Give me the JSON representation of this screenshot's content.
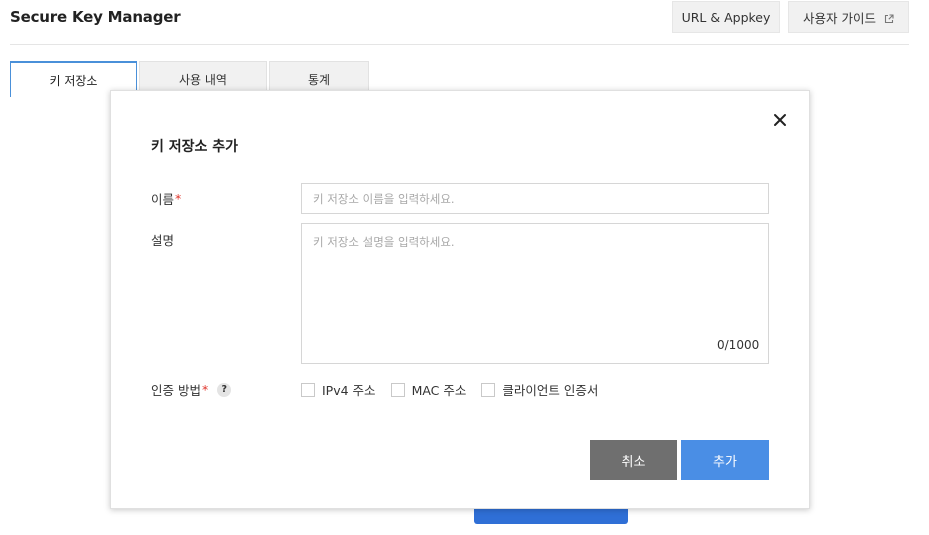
{
  "header": {
    "title": "Secure Key Manager",
    "url_appkey_label": "URL & Appkey",
    "user_guide_label": "사용자 가이드",
    "user_guide_icon": "external-link-icon"
  },
  "tabs": [
    {
      "label": "키 저장소",
      "active": true
    },
    {
      "label": "사용 내역",
      "active": false
    },
    {
      "label": "통계",
      "active": false
    }
  ],
  "modal": {
    "title": "키 저장소 추가",
    "close_icon": "close-icon",
    "name": {
      "label": "이름",
      "required_mark": "*",
      "placeholder": "키 저장소 이름을 입력하세요.",
      "value": ""
    },
    "description": {
      "label": "설명",
      "placeholder": "키 저장소 설명을 입력하세요.",
      "value": "",
      "char_count": "0/1000"
    },
    "auth_method": {
      "label": "인증 방법",
      "required_mark": "*",
      "help_icon_text": "?",
      "options": [
        {
          "label": "IPv4 주소",
          "checked": false
        },
        {
          "label": "MAC 주소",
          "checked": false
        },
        {
          "label": "클라이언트 인증서",
          "checked": false
        }
      ]
    },
    "cancel_label": "취소",
    "add_label": "추가"
  },
  "colors": {
    "primary_button": "#4a8ee5",
    "secondary_button": "#6f6f6f",
    "required_mark": "#e0352b",
    "active_tab_border": "#4a90d9"
  }
}
